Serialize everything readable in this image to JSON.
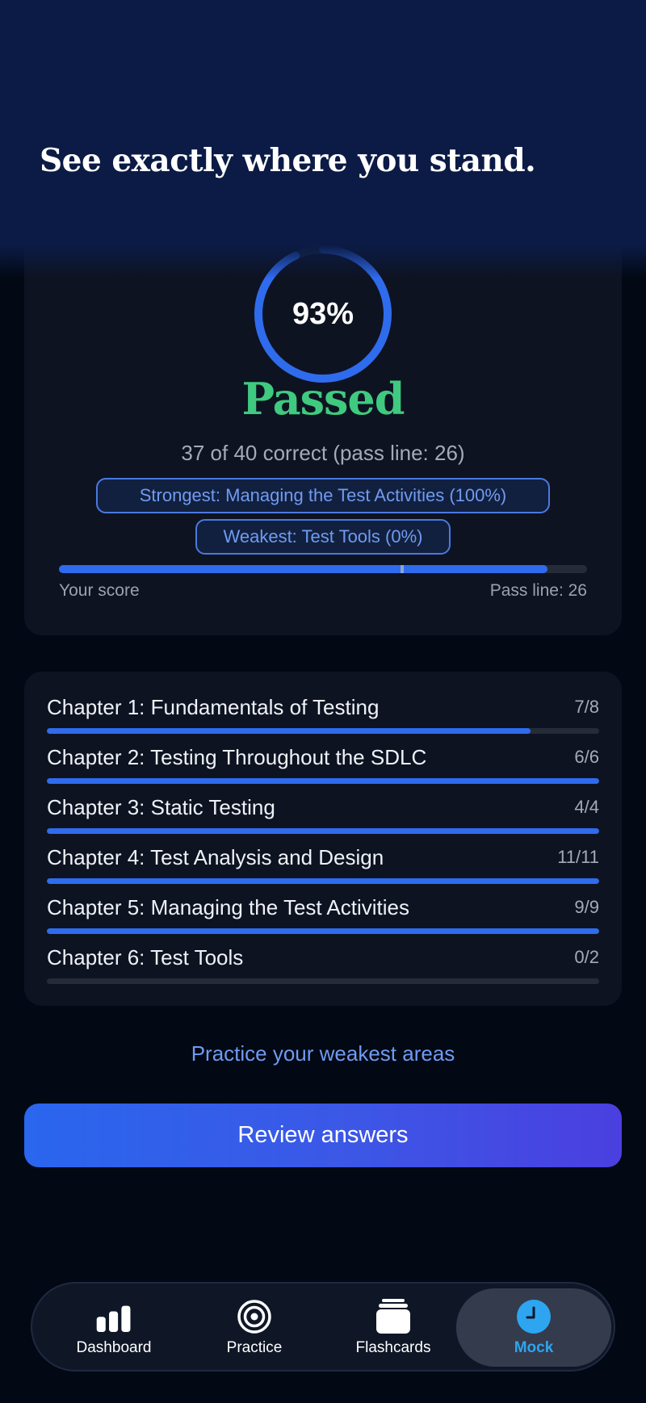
{
  "hero": {
    "title": "See exactly where you stand."
  },
  "result": {
    "percent_label": "93%",
    "percent": 93,
    "status": "Passed",
    "summary": "37 of 40 correct (pass line: 26)",
    "correct": 37,
    "total": 40,
    "pass_line": 26,
    "strongest": "Strongest: Managing the Test Activities (100%)",
    "weakest": "Weakest: Test Tools (0%)",
    "score_label": "Your score",
    "pass_label": "Pass line: 26"
  },
  "chapters": [
    {
      "name": "Chapter 1: Fundamentals of Testing",
      "score": "7/8",
      "correct": 7,
      "total": 8
    },
    {
      "name": "Chapter 2: Testing Throughout the SDLC",
      "score": "6/6",
      "correct": 6,
      "total": 6
    },
    {
      "name": "Chapter 3: Static Testing",
      "score": "4/4",
      "correct": 4,
      "total": 4
    },
    {
      "name": "Chapter 4: Test Analysis and Design",
      "score": "11/11",
      "correct": 11,
      "total": 11
    },
    {
      "name": "Chapter 5: Managing the Test Activities",
      "score": "9/9",
      "correct": 9,
      "total": 9
    },
    {
      "name": "Chapter 6: Test Tools",
      "score": "0/2",
      "correct": 0,
      "total": 2
    }
  ],
  "actions": {
    "practice_link": "Practice your weakest areas",
    "review_button": "Review answers"
  },
  "tabs": [
    {
      "label": "Dashboard",
      "icon": "bar-chart-icon",
      "active": false
    },
    {
      "label": "Practice",
      "icon": "target-icon",
      "active": false
    },
    {
      "label": "Flashcards",
      "icon": "cards-stack-icon",
      "active": false
    },
    {
      "label": "Mock",
      "icon": "clock-icon",
      "active": true
    }
  ],
  "colors": {
    "accent": "#2f6bed",
    "pass_green": "#3fca7f",
    "active_tab": "#2ea5f0",
    "background": "#020814",
    "card": "#0e1321"
  }
}
